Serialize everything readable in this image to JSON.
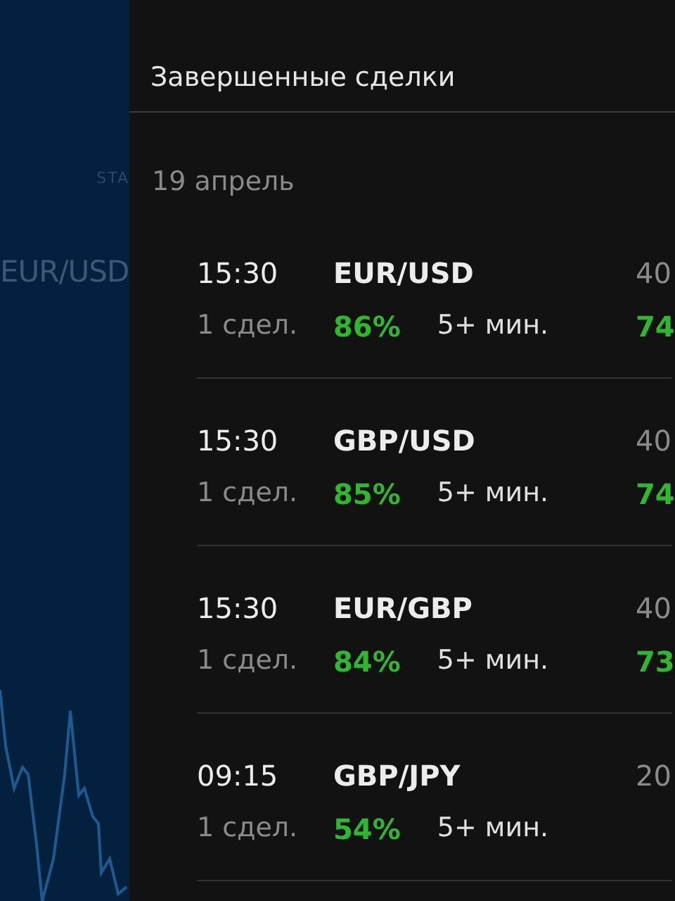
{
  "background_panel": {
    "label": "STA",
    "pair": "EUR/USD"
  },
  "panel": {
    "title": "Завершенные сделки",
    "date": "19 апрель",
    "trades": [
      {
        "time": "15:30",
        "pair": "EUR/USD",
        "count": "1 сдел.",
        "percent": "86%",
        "duration": "5+ мин.",
        "amount": "40",
        "result": "74"
      },
      {
        "time": "15:30",
        "pair": "GBP/USD",
        "count": "1 сдел.",
        "percent": "85%",
        "duration": "5+ мин.",
        "amount": "40",
        "result": "74"
      },
      {
        "time": "15:30",
        "pair": "EUR/GBP",
        "count": "1 сдел.",
        "percent": "84%",
        "duration": "5+ мин.",
        "amount": "40",
        "result": "73"
      },
      {
        "time": "09:15",
        "pair": "GBP/JPY",
        "count": "1 сдел.",
        "percent": "54%",
        "duration": "5+ мин.",
        "amount": "20"
      }
    ]
  }
}
